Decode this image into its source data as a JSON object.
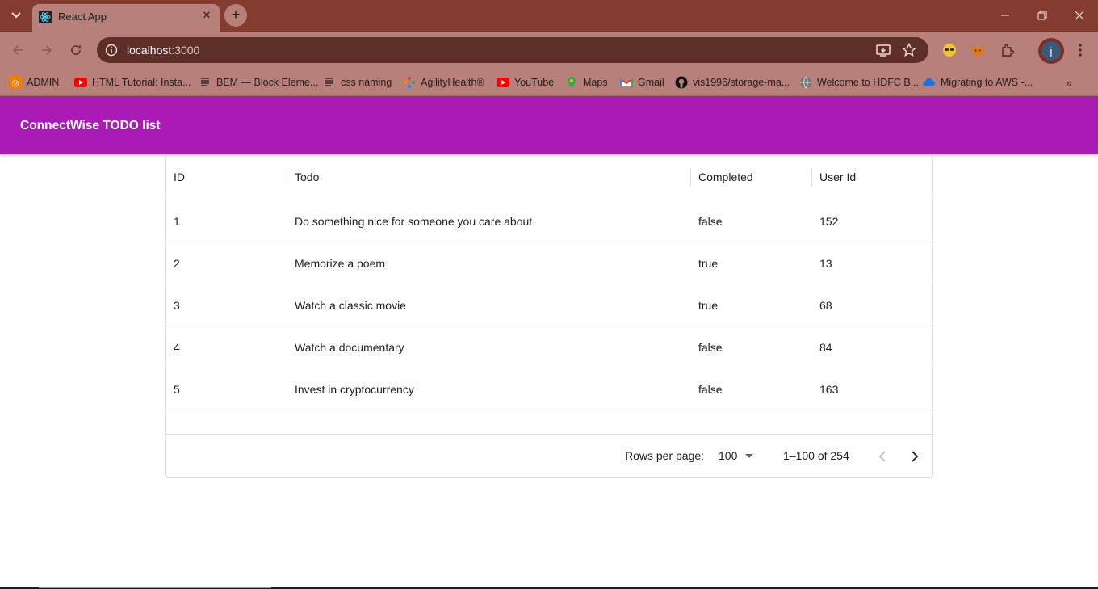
{
  "browser": {
    "tab_title": "React App",
    "url_host": "localhost",
    "url_port": ":3000",
    "accent": "#843b30",
    "profile_initial": "j",
    "bookmarks": [
      {
        "label": "ADMIN",
        "icon": "admin-icon"
      },
      {
        "label": "HTML Tutorial: Insta...",
        "icon": "youtube-icon"
      },
      {
        "label": "BEM — Block Eleme...",
        "icon": "document-icon"
      },
      {
        "label": "css naming",
        "icon": "document-icon"
      },
      {
        "label": "AgilityHealth®",
        "icon": "agility-icon"
      },
      {
        "label": "YouTube",
        "icon": "youtube-icon"
      },
      {
        "label": "Maps",
        "icon": "maps-icon"
      },
      {
        "label": "Gmail",
        "icon": "gmail-icon"
      },
      {
        "label": "vis1996/storage-ma...",
        "icon": "github-icon"
      },
      {
        "label": "Welcome to HDFC B...",
        "icon": "globe-icon"
      },
      {
        "label": "Migrating to AWS -...",
        "icon": "cloud-icon"
      }
    ]
  },
  "app": {
    "title": "ConnectWise TODO list",
    "bar_color": "#a91bb4"
  },
  "grid": {
    "columns": [
      "ID",
      "Todo",
      "Completed",
      "User Id"
    ],
    "rows": [
      {
        "id": "1",
        "todo": "Do something nice for someone you care about",
        "completed": "false",
        "user_id": "152"
      },
      {
        "id": "2",
        "todo": "Memorize a poem",
        "completed": "true",
        "user_id": "13"
      },
      {
        "id": "3",
        "todo": "Watch a classic movie",
        "completed": "true",
        "user_id": "68"
      },
      {
        "id": "4",
        "todo": "Watch a documentary",
        "completed": "false",
        "user_id": "84"
      },
      {
        "id": "5",
        "todo": "Invest in cryptocurrency",
        "completed": "false",
        "user_id": "163"
      }
    ],
    "pagination": {
      "rows_per_page_label": "Rows per page:",
      "rows_per_page_value": "100",
      "range_text": "1–100 of 254"
    }
  }
}
